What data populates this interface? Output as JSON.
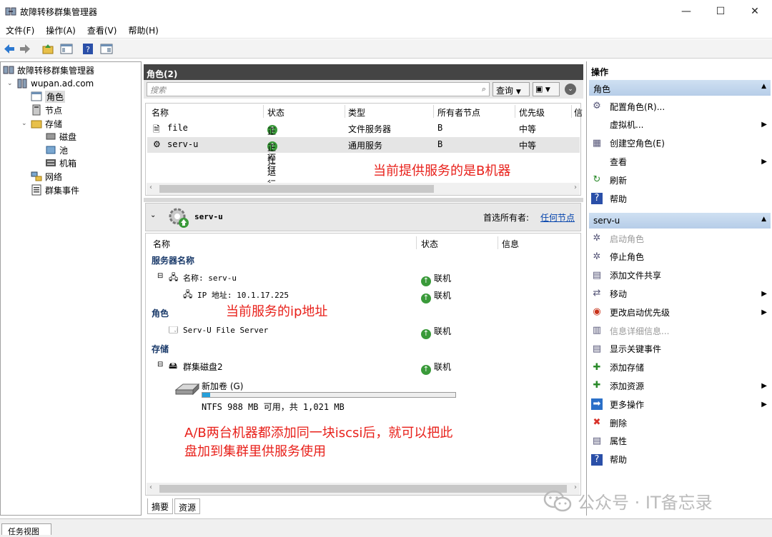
{
  "window": {
    "title": "故障转移群集管理器",
    "minimize": "—",
    "maximize": "☐",
    "close": "✕"
  },
  "menu": [
    "文件(F)",
    "操作(A)",
    "查看(V)",
    "帮助(H)"
  ],
  "tree": {
    "root": "故障转移群集管理器",
    "cluster": "wupan.ad.com",
    "roles": "角色",
    "nodes": "节点",
    "storage": "存储",
    "disks": "磁盘",
    "pools": "池",
    "enclosures": "机箱",
    "network": "网络",
    "events": "群集事件"
  },
  "center": {
    "header": "角色(2)",
    "search_placeholder": "搜索",
    "query_label": "查询",
    "columns": [
      "名称",
      "状态",
      "类型",
      "所有者节点",
      "优先级",
      "信"
    ],
    "rows": [
      {
        "name": "file",
        "status": "正在运行",
        "type": "文件服务器",
        "owner": "B",
        "priority": "中等"
      },
      {
        "name": "serv-u",
        "status": "正在运行",
        "type": "通用服务",
        "owner": "B",
        "priority": "中等"
      }
    ],
    "annotation1": "当前提供服务的是B机器",
    "detail": {
      "name": "serv-u",
      "preferred_owner_label": "首选所有者:",
      "preferred_owner_link": "任何节点",
      "columns": [
        "名称",
        "状态",
        "信息"
      ],
      "section_server": "服务器名称",
      "server_name": "名称: serv-u",
      "server_status": "联机",
      "ip_label": "IP 地址: 10.1.17.225",
      "ip_status": "联机",
      "annotation2": "当前服务的ip地址",
      "section_role": "角色",
      "role_item": "Serv-U File Server",
      "role_status": "联机",
      "section_storage": "存储",
      "disk_name": "群集磁盘2",
      "disk_status": "联机",
      "volume_name": "新加卷 (G)",
      "volume_usage": 0.03,
      "volume_info": "NTFS 988 MB 可用，共 1,021 MB",
      "annotation3_line1": "A/B两台机器都添加同一块iscsi后，就可以把此",
      "annotation3_line2": "盘加到集群里供服务使用"
    },
    "tabs": [
      "摘要",
      "资源"
    ]
  },
  "actions": {
    "header": "操作",
    "group1": "角色",
    "group1_items": [
      {
        "label": "配置角色(R)...",
        "icon": "configure-icon",
        "arrow": false
      },
      {
        "label": "虚拟机...",
        "icon": "",
        "arrow": true
      },
      {
        "label": "创建空角色(E)",
        "icon": "empty-role-icon",
        "arrow": false
      },
      {
        "label": "查看",
        "icon": "",
        "arrow": true
      },
      {
        "label": "刷新",
        "icon": "refresh-icon",
        "arrow": false
      },
      {
        "label": "帮助",
        "icon": "help-icon",
        "arrow": false
      }
    ],
    "group2": "serv-u",
    "group2_items": [
      {
        "label": "启动角色",
        "icon": "start-icon",
        "arrow": false,
        "disabled": true
      },
      {
        "label": "停止角色",
        "icon": "stop-icon",
        "arrow": false
      },
      {
        "label": "添加文件共享",
        "icon": "share-icon",
        "arrow": false
      },
      {
        "label": "移动",
        "icon": "move-icon",
        "arrow": true
      },
      {
        "label": "更改启动优先级",
        "icon": "priority-icon",
        "arrow": true
      },
      {
        "label": "信息详细信息...",
        "icon": "info-icon",
        "arrow": false,
        "disabled": true
      },
      {
        "label": "显示关键事件",
        "icon": "events-icon",
        "arrow": false
      },
      {
        "label": "添加存储",
        "icon": "add-storage-icon",
        "arrow": false
      },
      {
        "label": "添加资源",
        "icon": "add-resource-icon",
        "arrow": true
      },
      {
        "label": "更多操作",
        "icon": "more-icon",
        "arrow": true
      },
      {
        "label": "删除",
        "icon": "delete-icon",
        "arrow": false
      },
      {
        "label": "属性",
        "icon": "properties-icon",
        "arrow": false
      },
      {
        "label": "帮助",
        "icon": "help-icon",
        "arrow": false
      }
    ]
  },
  "statusbar": {
    "tab": "任务视图"
  },
  "watermark": "公众号 · IT备忘录",
  "colors": {
    "annotation": "#e8201a",
    "group_header": "#c3d7ee",
    "link": "#0645ad"
  }
}
